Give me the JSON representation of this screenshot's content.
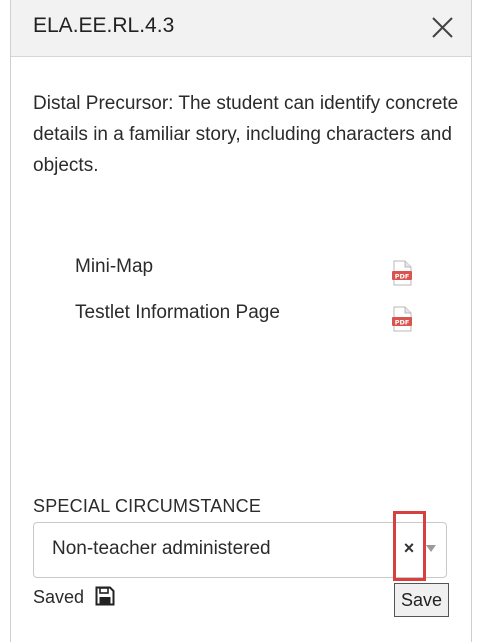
{
  "header": {
    "title": "ELA.EE.RL.4.3"
  },
  "description": "Distal Precursor: The student can identify concrete details in a familiar story, including characters and objects.",
  "resources": [
    {
      "label": "Mini-Map",
      "icon": "pdf-icon"
    },
    {
      "label": "Testlet Information Page",
      "icon": "pdf-icon"
    }
  ],
  "special_circumstance": {
    "label": "SPECIAL CIRCUMSTANCE",
    "selected": "Non-teacher administered",
    "clear_symbol": "×"
  },
  "status": {
    "saved_text": "Saved",
    "icon": "floppy-disk-icon"
  },
  "actions": {
    "save_label": "Save"
  },
  "colors": {
    "header_bg": "#f2f2f2",
    "highlight": "#d6403f",
    "pdf_red": "#d9534f"
  }
}
